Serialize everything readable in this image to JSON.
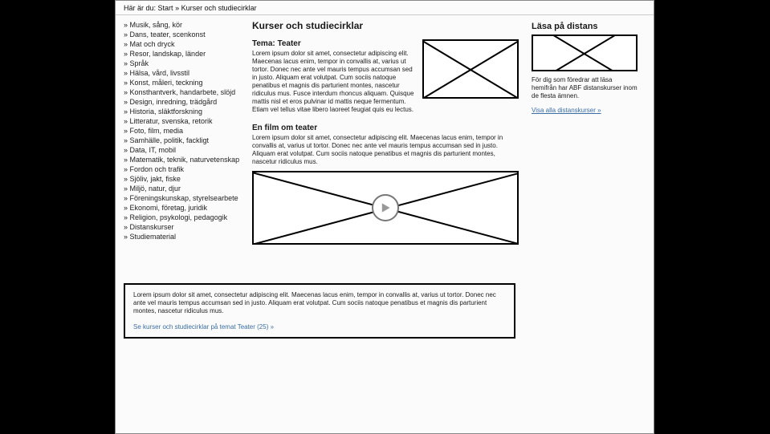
{
  "breadcrumb": {
    "prefix": "Här är du:   ",
    "crumb1": "Start",
    "sep": " » ",
    "crumb2": "Kurser och studiecirklar"
  },
  "sidebar": {
    "items": [
      "Musik, sång, kör",
      "Dans, teater, scenkonst",
      "Mat och dryck",
      "Resor, landskap, länder",
      "Språk",
      "Hälsa, vård, livsstil",
      "Konst, måleri, teckning",
      "Konsthantverk, handarbete, slöjd",
      "Design, inredning, trädgård",
      "Historia, släktforskning",
      "Litteratur, svenska, retorik",
      "Foto, film, media",
      "Samhälle, politik, fackligt",
      "Data, IT, mobil",
      "Matematik, teknik, naturvetenskap",
      "Fordon och trafik",
      "Sjöliv, jakt, fiske",
      "Miljö, natur, djur",
      "Föreningskunskap, styrelsearbete",
      "Ekonomi, företag, juridik",
      "Religion, psykologi, pedagogik",
      "Distanskurser",
      "Studiematerial"
    ]
  },
  "main": {
    "title": "Kurser och studiecirklar",
    "tema_heading": "Tema: Teater",
    "tema_body": "Lorem ipsum dolor sit amet, consectetur adipiscing elit. Maecenas lacus enim, tempor in convallis at, varius ut tortor. Donec nec ante vel mauris tempus accumsan sed in justo. Aliquam erat volutpat. Cum sociis natoque penatibus et magnis dis parturient montes, nascetur ridiculus mus. Fusce interdum rhoncus aliquam. Quisque mattis nisl et eros pulvinar id mattis neque fermentum. Etiam vel tellus vitae libero laoreet feugiat quis eu lectus.",
    "film_heading": "En film om teater",
    "film_body": "Lorem ipsum dolor sit amet, consectetur adipiscing elit. Maecenas lacus enim, tempor in convallis at, varius ut tortor. Donec nec ante vel mauris tempus accumsan sed in justo. Aliquam erat volutpat. Cum sociis natoque penatibus et magnis dis parturient montes, nascetur ridiculus mus.",
    "lower_body": "Lorem ipsum dolor sit amet, consectetur adipiscing elit. Maecenas lacus enim, tempor in convallis at, varius ut tortor. Donec nec ante vel mauris tempus accumsan sed in justo. Aliquam erat volutpat. Cum sociis natoque penatibus et magnis dis parturient montes, nascetur ridiculus mus.",
    "lower_link": "Se kurser och studiecirklar på temat Teater (25) »"
  },
  "right": {
    "title": "Läsa på distans",
    "body": "För dig som föredrar att läsa hemifrån har ABF distanskurser inom de flesta ämnen.",
    "link": "Visa alla distanskurser »"
  }
}
